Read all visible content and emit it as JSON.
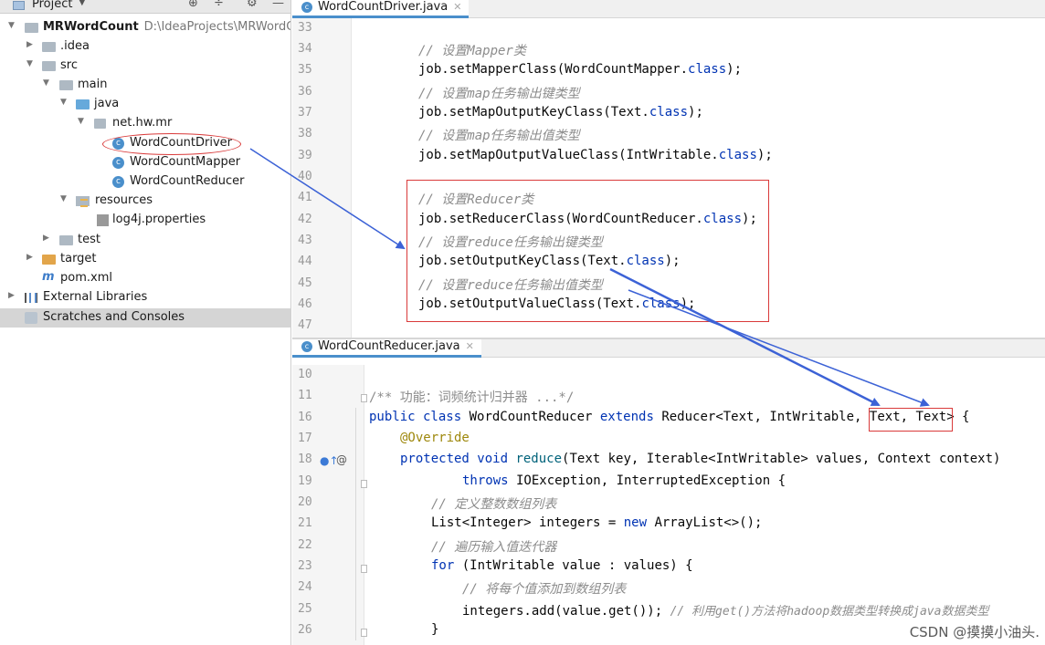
{
  "project_panel": {
    "header": {
      "title": "Project"
    },
    "tree": [
      {
        "label": "MRWordCount",
        "path": "D:\\IdeaProjects\\MRWordCo"
      },
      {
        "label": ".idea"
      },
      {
        "label": "src"
      },
      {
        "label": "main"
      },
      {
        "label": "java"
      },
      {
        "label": "net.hw.mr"
      },
      {
        "label": "WordCountDriver"
      },
      {
        "label": "WordCountMapper"
      },
      {
        "label": "WordCountReducer"
      },
      {
        "label": "resources"
      },
      {
        "label": "log4j.properties"
      },
      {
        "label": "test"
      },
      {
        "label": "target"
      },
      {
        "label": "pom.xml"
      },
      {
        "label": "External Libraries"
      },
      {
        "label": "Scratches and Consoles"
      }
    ]
  },
  "top_editor": {
    "tab": {
      "label": "WordCountDriver.java"
    },
    "lines": [
      {
        "num": "33"
      },
      {
        "num": "34",
        "comment": "// 设置Mapper类"
      },
      {
        "num": "35",
        "pre": "job.setMapperClass(WordCountMapper.",
        "kw": "class",
        "post": ");"
      },
      {
        "num": "36",
        "comment": "// 设置map任务输出键类型"
      },
      {
        "num": "37",
        "pre": "job.setMapOutputKeyClass(Text.",
        "kw": "class",
        "post": ");"
      },
      {
        "num": "38",
        "comment": "// 设置map任务输出值类型"
      },
      {
        "num": "39",
        "pre": "job.setMapOutputValueClass(IntWritable.",
        "kw": "class",
        "post": ");"
      },
      {
        "num": "40"
      },
      {
        "num": "41",
        "comment": "// 设置Reducer类"
      },
      {
        "num": "42",
        "pre": "job.setReducerClass(WordCountReducer.",
        "kw": "class",
        "post": ");"
      },
      {
        "num": "43",
        "comment": "// 设置reduce任务输出键类型"
      },
      {
        "num": "44",
        "pre": "job.setOutputKeyClass(Text.",
        "kw": "class",
        "post": ");"
      },
      {
        "num": "45",
        "comment": "// 设置reduce任务输出值类型"
      },
      {
        "num": "46",
        "pre": "job.setOutputValueClass(Text.",
        "kw": "class",
        "post": ");"
      },
      {
        "num": "47"
      }
    ]
  },
  "bottom_editor": {
    "tab": {
      "label": "WordCountReducer.java"
    },
    "lines": {
      "l10": {
        "num": "10"
      },
      "l11": {
        "num": "11",
        "text": "/** 功能：词频统计归并器 ...*/"
      },
      "l16": {
        "num": "16",
        "kw1": "public class",
        "mid": " WordCountReducer ",
        "kw2": "extends",
        "post": " Reducer<Text, IntWritable, ",
        "boxed": "Text, Text",
        "end": "> {"
      },
      "l17": {
        "num": "17",
        "text": "@Override"
      },
      "l18": {
        "num": "18",
        "kw": "protected void",
        "mth": " reduce",
        "post": "(Text key, Iterable<IntWritable> values, Context context)"
      },
      "l19": {
        "num": "19",
        "kw": "throws",
        "post": " IOException, InterruptedException {"
      },
      "l20": {
        "num": "20",
        "comment": "// 定义整数数组列表"
      },
      "l21": {
        "num": "21",
        "pre": "List<Integer> integers = ",
        "kw": "new",
        "post": " ArrayList<>();"
      },
      "l22": {
        "num": "22",
        "comment": "// 遍历输入值迭代器"
      },
      "l23": {
        "num": "23",
        "kw": "for",
        "post": " (IntWritable value : values) {"
      },
      "l24": {
        "num": "24",
        "comment": "// 将每个值添加到数组列表"
      },
      "l25": {
        "num": "25",
        "pre": "integers.add(value.get()); ",
        "comment": "// 利用get()方法将hadoop数据类型转换成java数据类型"
      },
      "l26": {
        "num": "26",
        "text": "}"
      }
    }
  },
  "watermark": "CSDN @摸摸小油头.",
  "colors": {
    "annotation_red": "#d93a3a",
    "arrow_blue": "#3c62d6",
    "keyword": "#0033b3",
    "comment": "#8c8c8c"
  }
}
